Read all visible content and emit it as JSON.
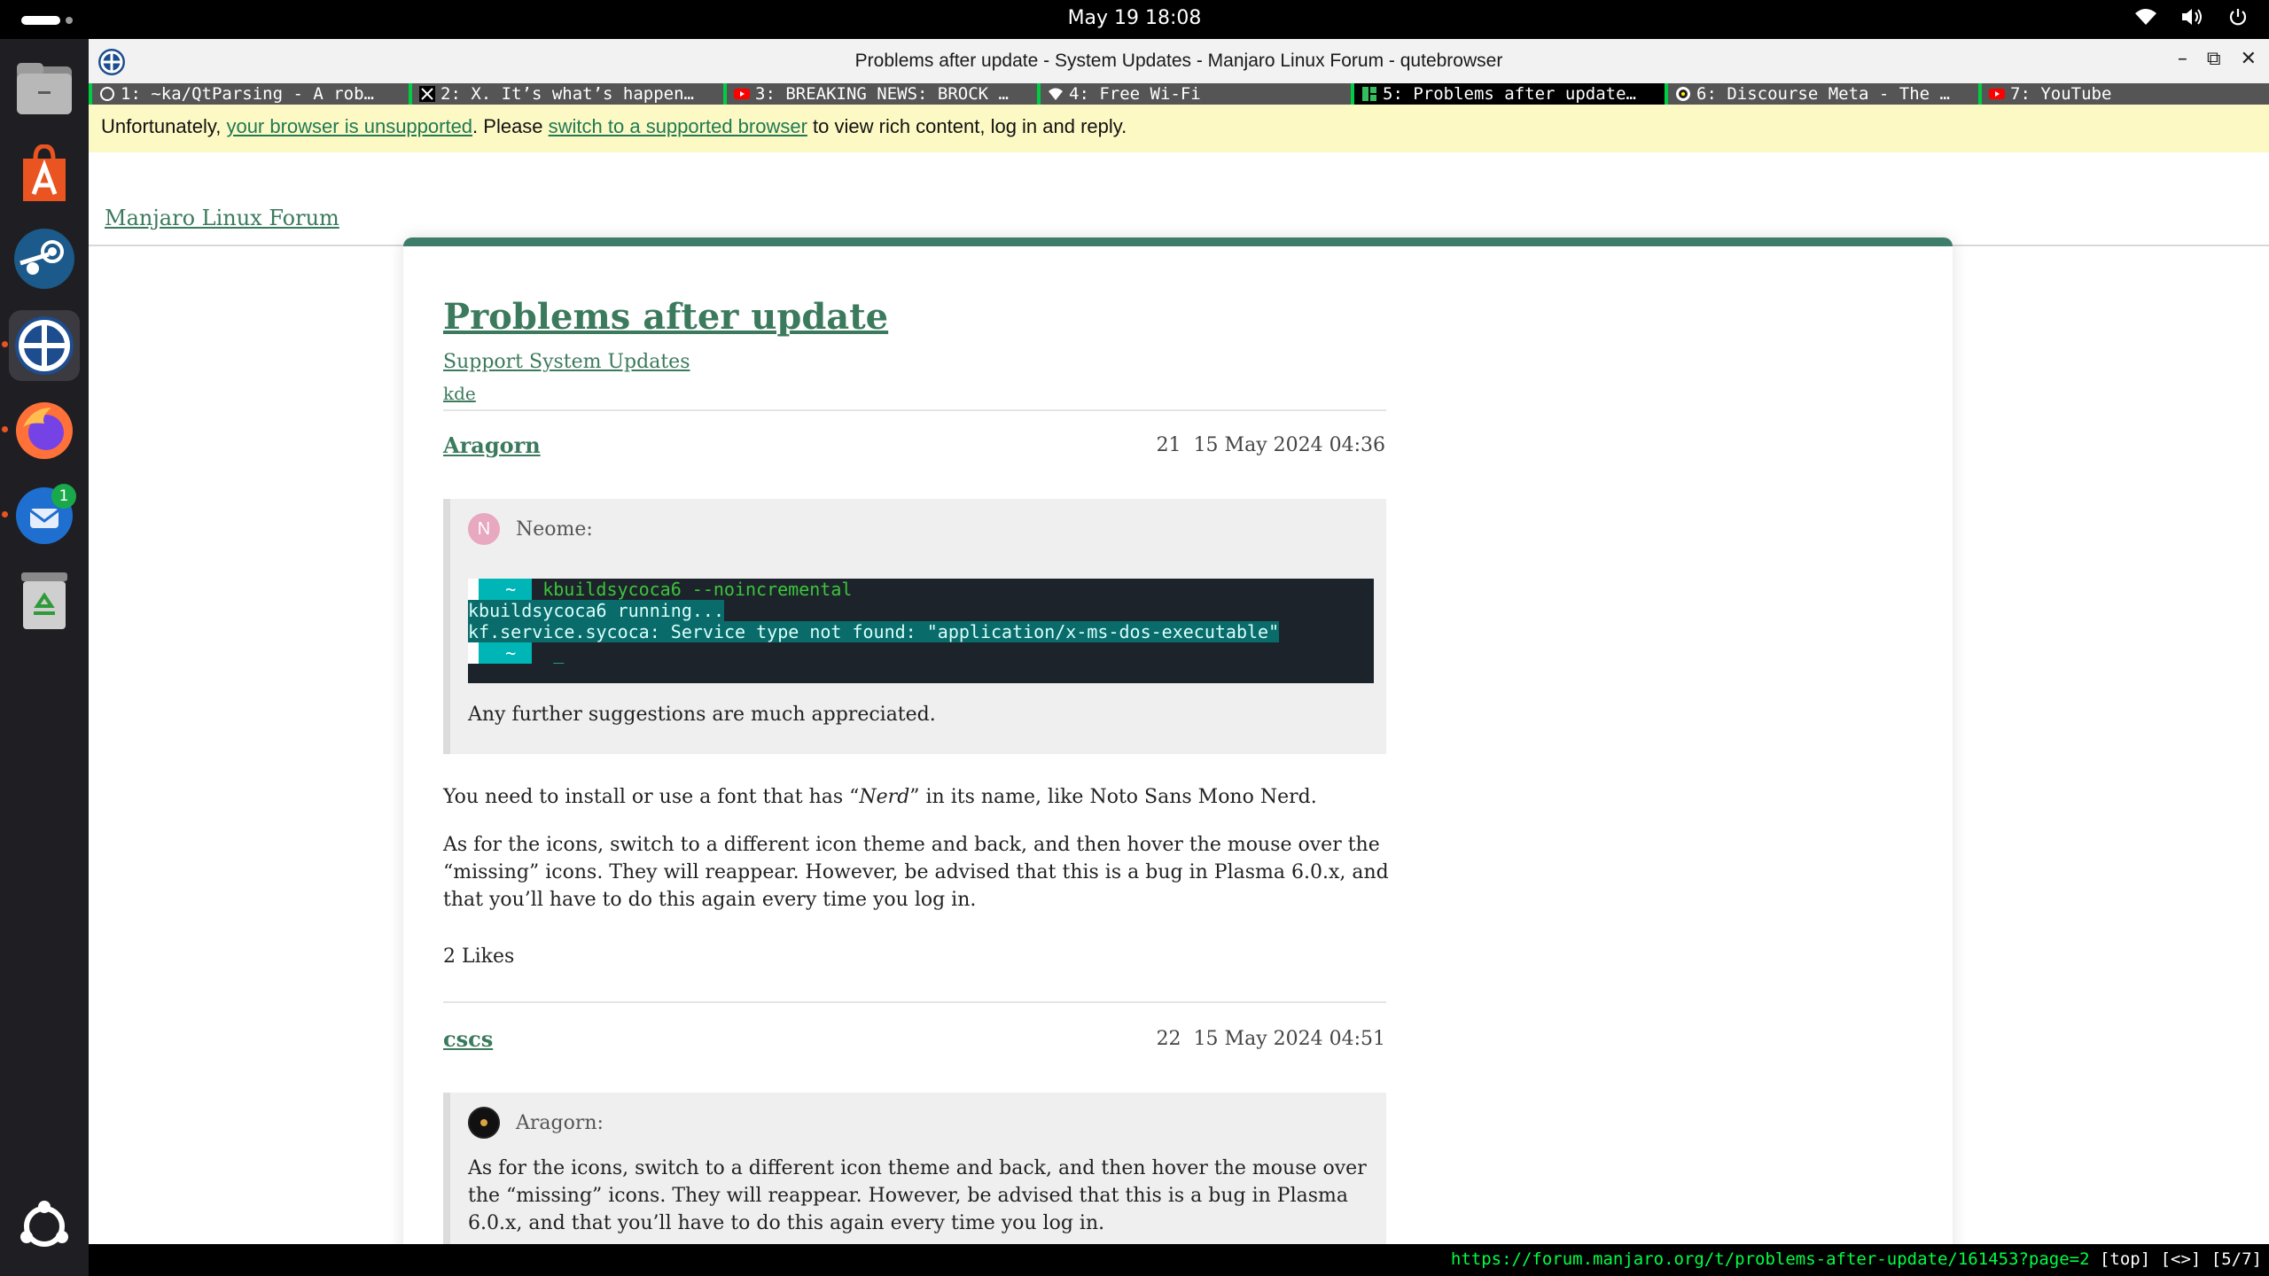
{
  "topbar": {
    "clock": "May 19  18:08"
  },
  "dock": {
    "badge_count": "1"
  },
  "window": {
    "title": "Problems after update - System Updates - Manjaro Linux Forum - qutebrowser",
    "tabs": [
      {
        "label": "1: ~ka/QtParsing - A rob…",
        "icon": "github-icon"
      },
      {
        "label": "2: X. It’s what’s happen…",
        "icon": "x-icon"
      },
      {
        "label": "3: BREAKING NEWS: BROCK …",
        "icon": "youtube-icon"
      },
      {
        "label": "4: Free Wi-Fi",
        "icon": "wifi-icon"
      },
      {
        "label": "5: Problems after update…",
        "icon": "manjaro-icon"
      },
      {
        "label": "6: Discourse Meta - The …",
        "icon": "discourse-icon"
      },
      {
        "label": "7: YouTube",
        "icon": "youtube-icon"
      }
    ]
  },
  "banner": {
    "text1": "Unfortunately, ",
    "link1": "your browser is unsupported",
    "text2": ". Please ",
    "link2": "switch to a supported browser",
    "text3": " to view rich content, log in and reply."
  },
  "forum": {
    "home_link": "Manjaro Linux Forum"
  },
  "topic": {
    "title": "Problems after update",
    "category": "Support System Updates",
    "tag": "kde"
  },
  "posts": [
    {
      "author": "Aragorn",
      "number": "21",
      "date": "15 May 2024 04:36",
      "quote_author": "Neome:",
      "quote_avatar_letter": "N",
      "terminal": {
        "prompt_glyphs_white": "",
        "prompt_glyphs_teal": "  ~ ",
        "cmd_line_1": " kbuildsycoca6 --noincremental",
        "line_2": "kbuildsycoca6 running...",
        "line_3": "kf.service.sycoca: Service type not found: \"application/x-ms-dos-executable\"",
        "cursor_line": "  _"
      },
      "quote_text": "Any further suggestions are much appreciated.",
      "body_1_before": "You need to install or use a font that has “",
      "body_1_em": "Nerd",
      "body_1_after": "” in its name, like Noto Sans Mono Nerd.",
      "body_2": "As for the icons, switch to a different icon theme and back, and then hover the mouse over the “missing” icons. They will reappear. However, be advised that this is a bug in Plasma 6.0.x, and that you’ll have to do this again every time you log in.",
      "likes": "2 Likes"
    },
    {
      "author": "cscs",
      "number": "22",
      "date": "15 May 2024 04:51",
      "quote_author": "Aragorn:",
      "quote_text": "As for the icons, switch to a different icon theme and back, and then hover the mouse over the “missing” icons. They will reappear. However, be advised that this is a bug in Plasma 6.0.x, and that you’ll have to do this again every time you log in."
    }
  ],
  "statusbar": {
    "url": "https://forum.manjaro.org/t/problems-after-update/161453?page=2",
    "position": " [top] [<>] [5/7]"
  },
  "colors": {
    "accent": "#3b7a5c",
    "card_border": "#3f7d6b",
    "banner_bg": "#fdf9c4",
    "tab_indicator": "#00cc44"
  }
}
